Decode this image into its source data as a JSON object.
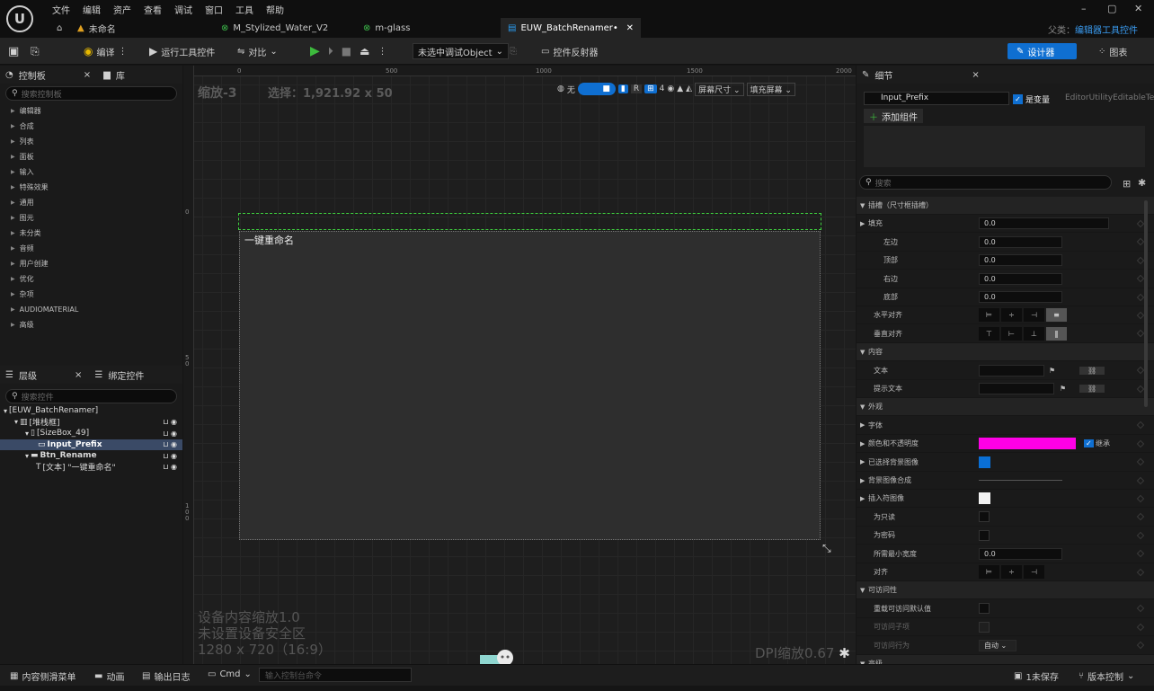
{
  "app": {
    "menu": [
      "文件",
      "编辑",
      "资产",
      "查看",
      "调试",
      "窗口",
      "工具",
      "帮助"
    ],
    "tabs": [
      {
        "label": "未命名",
        "active": false
      },
      {
        "label": "M_Stylized_Water_V2",
        "active": false
      },
      {
        "label": "m-glass",
        "active": false
      },
      {
        "label": "EUW_BatchRenamer•",
        "active": true
      }
    ],
    "parent_class_label": "父类：",
    "parent_class_value": "编辑器工具控件",
    "min_glyph": "–",
    "max_glyph": "▢",
    "close_glyph": "✕",
    "close_tab_glyph": "✕",
    "logo_glyph": "U"
  },
  "toolbar": {
    "compile": "编译",
    "run": "运行工具控件",
    "diff": "对比",
    "debug_object": "未选中调试Object",
    "widget_reflector": "控件反射器",
    "designer": "设计器",
    "graph": "图表"
  },
  "left_panel": {
    "palette_tab": "控制板",
    "library_tab": "库",
    "palette_search_placeholder": "搜索控制板",
    "categories": [
      "编辑器",
      "合成",
      "列表",
      "面板",
      "输入",
      "特殊效果",
      "通用",
      "图元",
      "未分类",
      "音频",
      "用户创建",
      "优化",
      "杂项",
      "AUDIOMATERIAL",
      "高级"
    ],
    "hierarchy_tab": "层级",
    "bind_tab": "绑定控件",
    "hierarchy_search_placeholder": "搜索控件",
    "tree": [
      {
        "label": "[EUW_BatchRenamer]",
        "indent": 0,
        "sel": false
      },
      {
        "label": "[堆栈框]",
        "indent": 1,
        "sel": false
      },
      {
        "label": "[SizeBox_49]",
        "indent": 2,
        "sel": false
      },
      {
        "label": "Input_Prefix",
        "indent": 3,
        "sel": true
      },
      {
        "label": "Btn_Rename",
        "indent": 2,
        "sel": false
      },
      {
        "label": "[文本] \"一键重命名\"",
        "indent": 3,
        "sel": false
      }
    ]
  },
  "canvas": {
    "zoom": "缩放-3",
    "selection": "选择：1,921.92 x 50",
    "ruler_top": [
      "0",
      "500",
      "1000",
      "1500",
      "2000"
    ],
    "ruler_left": [
      "0",
      "5\n0",
      "1\n0\n0"
    ],
    "button_text": "一键重命名",
    "none_label": "无",
    "r_label": "R",
    "grid_count": "4",
    "screen_size": "屏幕尺寸",
    "fill_screen": "填充屏幕",
    "device_scale": "设备内容缩放1.0",
    "safe_zone": "未设置设备安全区",
    "resolution": "1280 x 720（16:9）",
    "dpi": "DPI缩放0.67"
  },
  "details": {
    "tab": "细节",
    "name_value": "Input_Prefix",
    "is_variable": "是变量",
    "class_name": "EditorUtilityEditableText",
    "add_component": "添加组件",
    "search_placeholder": "搜索",
    "rows": [
      {
        "label": "插槽（尺寸框插槽）",
        "type": "section"
      },
      {
        "label": "填充",
        "type": "field",
        "value": "0.0",
        "wide": true,
        "tri": true
      },
      {
        "label": "左边",
        "type": "field",
        "value": "0.0",
        "sub": true
      },
      {
        "label": "顶部",
        "type": "field",
        "value": "0.0",
        "sub": true
      },
      {
        "label": "右边",
        "type": "field",
        "value": "0.0",
        "sub": true
      },
      {
        "label": "底部",
        "type": "field",
        "value": "0.0",
        "sub": true
      },
      {
        "label": "水平对齐",
        "type": "halign"
      },
      {
        "label": "垂直对齐",
        "type": "valign"
      },
      {
        "label": "内容",
        "type": "section"
      },
      {
        "label": "文本",
        "type": "textfield"
      },
      {
        "label": "提示文本",
        "type": "textfield"
      },
      {
        "label": "外观",
        "type": "section"
      },
      {
        "label": "字体",
        "type": "plain",
        "tri": true
      },
      {
        "label": "颜色和不透明度",
        "type": "color",
        "color": "#ff00e6",
        "tri": true
      },
      {
        "label": "已选择背景图像",
        "type": "swatch",
        "color": "#0a6fd6",
        "tri": true
      },
      {
        "label": "背景图像合成",
        "type": "line",
        "tri": true
      },
      {
        "label": "插入符图像",
        "type": "swatch",
        "color": "#f2f2f2",
        "tri": true
      },
      {
        "label": "为只读",
        "type": "check"
      },
      {
        "label": "为密码",
        "type": "check"
      },
      {
        "label": "所需最小宽度",
        "type": "field",
        "value": "0.0"
      },
      {
        "label": "对齐",
        "type": "justify"
      },
      {
        "label": "可访问性",
        "type": "section"
      },
      {
        "label": "重载可访问默认值",
        "type": "check"
      },
      {
        "label": "可访问子项",
        "type": "check",
        "dim": true
      },
      {
        "label": "可访问行为",
        "type": "dropdown",
        "value": "自动",
        "dim": true
      },
      {
        "label": "高级",
        "type": "section"
      }
    ],
    "inherit_label": "继承"
  },
  "statusbar": {
    "content_drawer": "内容侧滑菜单",
    "animation": "动画",
    "output_log": "输出日志",
    "cmd": "Cmd",
    "console_placeholder": "输入控制台命令",
    "unsaved": "1未保存",
    "source_control": "版本控制"
  },
  "colors": {
    "accent": "#0f6fd1",
    "selection_outline": "#3ed13e",
    "play": "#3dbb3d"
  }
}
